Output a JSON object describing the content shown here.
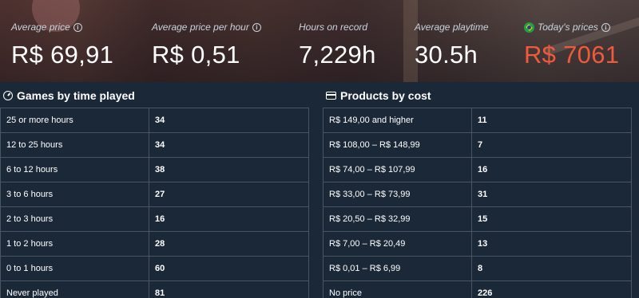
{
  "stats": {
    "avg_price": {
      "label": "Average price",
      "value": "R$ 69,91"
    },
    "avg_price_hour": {
      "label": "Average price per hour",
      "value": "R$ 0,51"
    },
    "hours": {
      "label": "Hours on record",
      "value": "7,229h"
    },
    "avg_playtime": {
      "label": "Average playtime",
      "value": "30.5h"
    },
    "today": {
      "label": "Today's prices",
      "value": "R$ 7061",
      "color": "#f05a3c"
    }
  },
  "time_played": {
    "title": "Games by time played",
    "rows": [
      {
        "label": "25 or more hours",
        "count": "34"
      },
      {
        "label": "12 to 25 hours",
        "count": "34"
      },
      {
        "label": "6 to 12 hours",
        "count": "38"
      },
      {
        "label": "3 to 6 hours",
        "count": "27"
      },
      {
        "label": "2 to 3 hours",
        "count": "16"
      },
      {
        "label": "1 to 2 hours",
        "count": "28"
      },
      {
        "label": "0 to 1 hours",
        "count": "60"
      },
      {
        "label": "Never played",
        "count": "81"
      }
    ]
  },
  "cost": {
    "title": "Products by cost",
    "rows": [
      {
        "label": "R$ 149,00 and higher",
        "count": "11"
      },
      {
        "label": "R$ 108,00 – R$ 148,99",
        "count": "7"
      },
      {
        "label": "R$ 74,00 – R$ 107,99",
        "count": "16"
      },
      {
        "label": "R$ 33,00 – R$ 73,99",
        "count": "31"
      },
      {
        "label": "R$ 20,50 – R$ 32,99",
        "count": "15"
      },
      {
        "label": "R$ 7,00 – R$ 20,49",
        "count": "13"
      },
      {
        "label": "R$ 0,01 – R$ 6,99",
        "count": "8"
      },
      {
        "label": "No price",
        "count": "226"
      }
    ]
  }
}
